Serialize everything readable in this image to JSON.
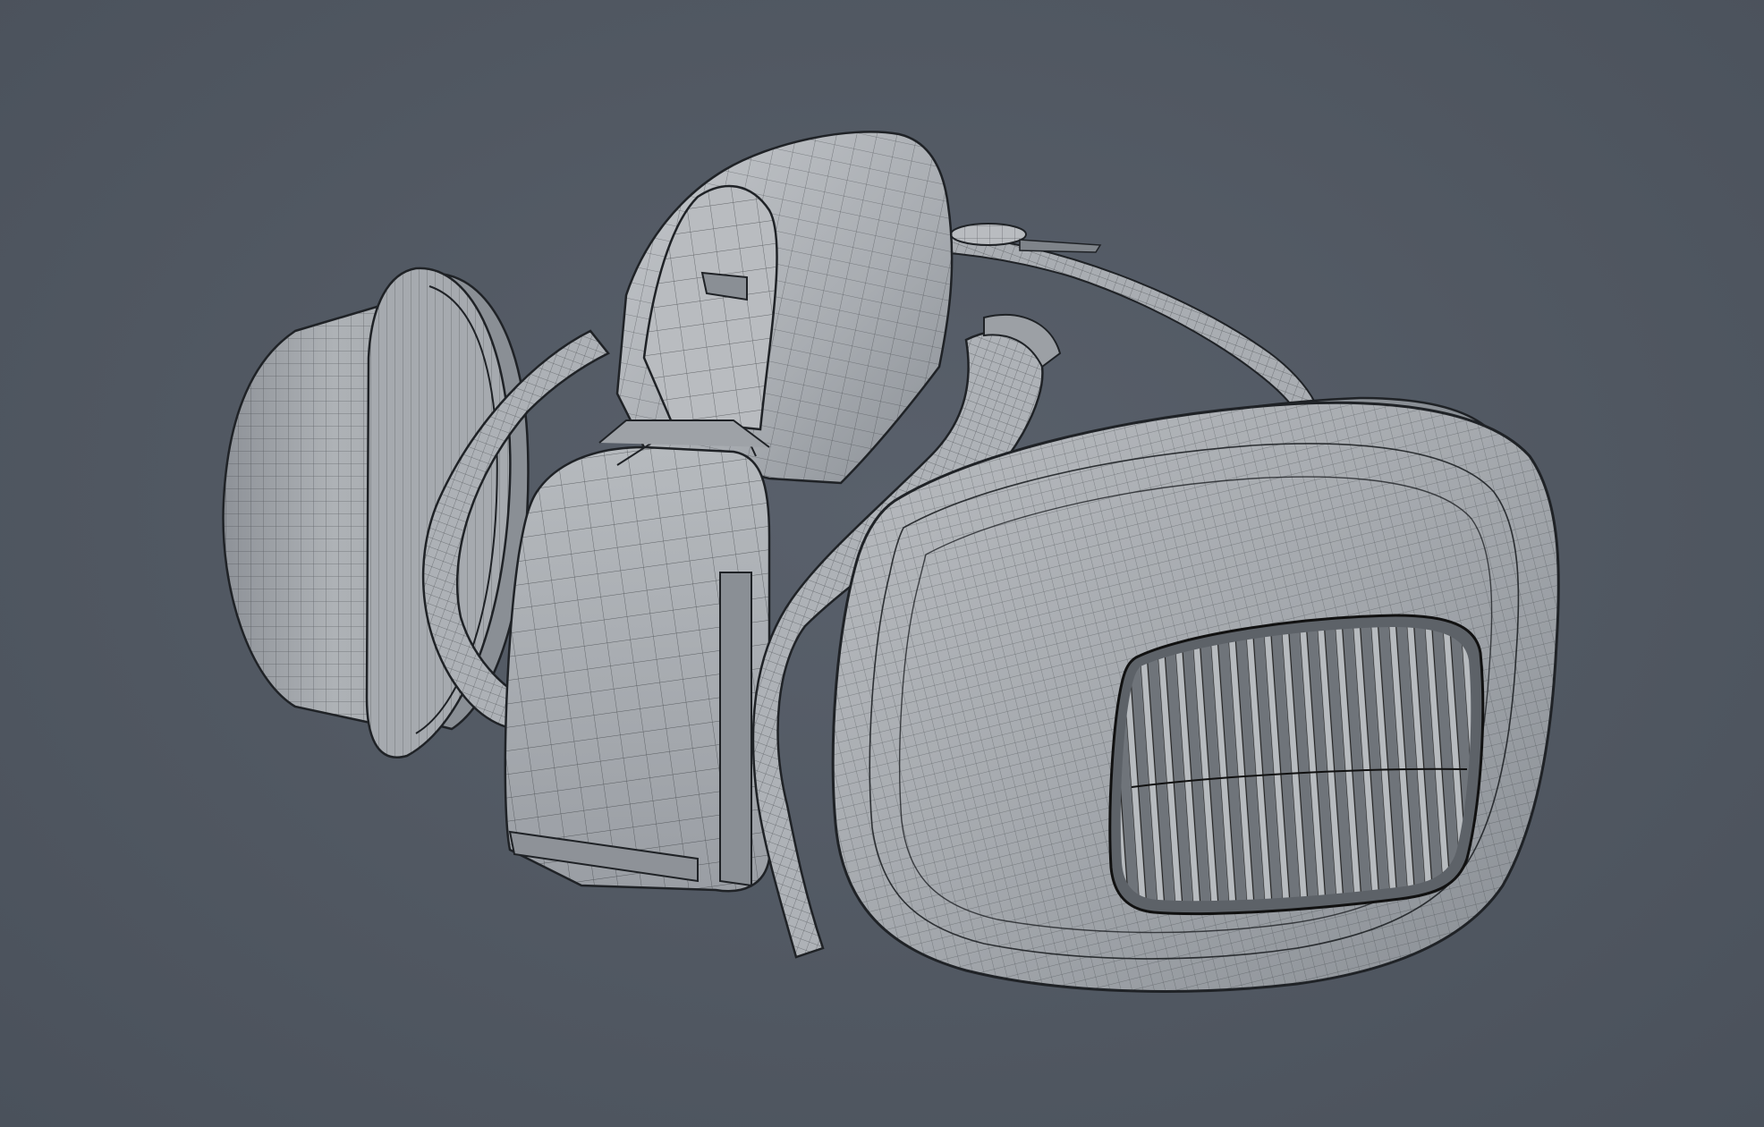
{
  "scene": {
    "subject": "respirator-mask-wireframe",
    "render_style": "grey-shaded-wireframe",
    "colors": {
      "background": "#505762",
      "surface": "#a9adb2",
      "surface_dark": "#7f848a",
      "surface_light": "#c3c6ca",
      "wire": "#2a2d31"
    },
    "parts": [
      "left-filter-cartridge",
      "nose-bridge-shell",
      "front-valve-housing",
      "right-filter-cartridge",
      "right-filter-grille",
      "head-strap",
      "strap-buckle",
      "cheek-strap-left",
      "cheek-strap-right"
    ]
  }
}
